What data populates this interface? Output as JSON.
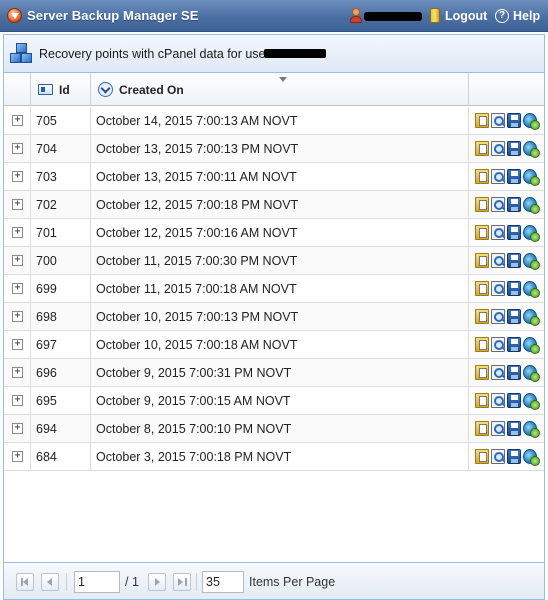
{
  "app": {
    "title": "Server Backup Manager SE",
    "logout_label": "Logout",
    "help_label": "Help",
    "help_glyph": "?"
  },
  "panel": {
    "title": "Recovery points with cPanel data for user"
  },
  "grid": {
    "columns": [
      "Id",
      "Created On"
    ],
    "expander_glyph": "+",
    "rows": [
      {
        "id": "705",
        "created_on": "October 14, 2015 7:00:13 AM NOVT"
      },
      {
        "id": "704",
        "created_on": "October 13, 2015 7:00:13 PM NOVT"
      },
      {
        "id": "703",
        "created_on": "October 13, 2015 7:00:11 AM NOVT"
      },
      {
        "id": "702",
        "created_on": "October 12, 2015 7:00:18 PM NOVT"
      },
      {
        "id": "701",
        "created_on": "October 12, 2015 7:00:16 AM NOVT"
      },
      {
        "id": "700",
        "created_on": "October 11, 2015 7:00:30 PM NOVT"
      },
      {
        "id": "699",
        "created_on": "October 11, 2015 7:00:18 AM NOVT"
      },
      {
        "id": "698",
        "created_on": "October 10, 2015 7:00:13 PM NOVT"
      },
      {
        "id": "697",
        "created_on": "October 10, 2015 7:00:18 AM NOVT"
      },
      {
        "id": "696",
        "created_on": "October 9, 2015 7:00:31 PM NOVT"
      },
      {
        "id": "695",
        "created_on": "October 9, 2015 7:00:15 AM NOVT"
      },
      {
        "id": "694",
        "created_on": "October 8, 2015 7:00:10 PM NOVT"
      },
      {
        "id": "684",
        "created_on": "October 3, 2015 7:00:18 PM NOVT"
      }
    ],
    "row_action_icons": [
      "browse-icon",
      "search-icon",
      "save-icon",
      "restore-icon"
    ]
  },
  "pager": {
    "current_page": "1",
    "page_of": "/ 1",
    "per_page": "35",
    "per_page_label": "Items Per Page"
  },
  "icons": {
    "app": "shield-icon",
    "user": "user-icon",
    "logout": "logout-icon",
    "help": "help-icon",
    "panel": "cubes-icon",
    "id_column": "id-card-icon",
    "created_column": "clock-icon"
  },
  "colors": {
    "topbar": "#4b6fa3",
    "panel_border": "#99bbe8",
    "panel_header": "#dfe8f6"
  }
}
